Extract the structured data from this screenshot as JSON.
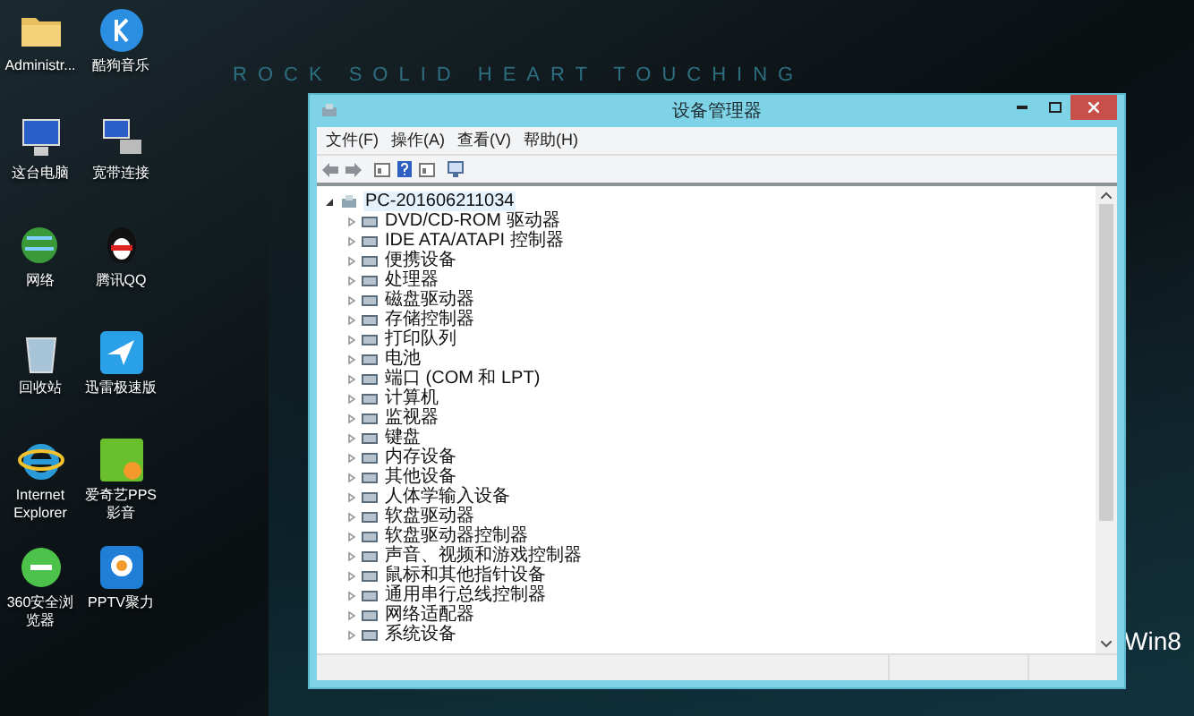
{
  "desktop": {
    "icons": [
      {
        "label": "Administr...",
        "kind": "folder"
      },
      {
        "label": "酷狗音乐",
        "kind": "round-app"
      },
      {
        "label": "这台电脑",
        "kind": "computer"
      },
      {
        "label": "宽带连接",
        "kind": "network"
      },
      {
        "label": "网络",
        "kind": "globe"
      },
      {
        "label": "腾讯QQ",
        "kind": "penguin"
      },
      {
        "label": "回收站",
        "kind": "bin"
      },
      {
        "label": "迅雷极速版",
        "kind": "bird-tile"
      },
      {
        "label": "Internet Explorer",
        "kind": "ie"
      },
      {
        "label": "爱奇艺PPS 影音",
        "kind": "green-tile"
      },
      {
        "label": "360安全浏览器",
        "kind": "green-e"
      },
      {
        "label": "PPTV聚力",
        "kind": "blue-tile"
      }
    ],
    "wallpaper_text": [
      "ROCK SOLID   HEART TOUCHING",
      "Win8"
    ]
  },
  "window": {
    "title": "设备管理器",
    "menu": [
      "文件(F)",
      "操作(A)",
      "查看(V)",
      "帮助(H)"
    ],
    "tree": {
      "label": "PC-201606211034",
      "selected": true,
      "expanded": true,
      "children": [
        {
          "label": "DVD/CD-ROM 驱动器",
          "selected": false
        },
        {
          "label": "IDE ATA/ATAPI 控制器",
          "selected": false
        },
        {
          "label": "便携设备",
          "selected": false
        },
        {
          "label": "处理器",
          "selected": false
        },
        {
          "label": "磁盘驱动器",
          "selected": false
        },
        {
          "label": "存储控制器",
          "selected": false
        },
        {
          "label": "打印队列",
          "selected": false
        },
        {
          "label": "电池",
          "selected": false
        },
        {
          "label": "端口 (COM 和 LPT)",
          "selected": false
        },
        {
          "label": "计算机",
          "selected": false
        },
        {
          "label": "监视器",
          "selected": false
        },
        {
          "label": "键盘",
          "selected": false
        },
        {
          "label": "内存设备",
          "selected": false
        },
        {
          "label": "其他设备",
          "selected": false
        },
        {
          "label": "人体学输入设备",
          "selected": false
        },
        {
          "label": "软盘驱动器",
          "selected": false
        },
        {
          "label": "软盘驱动器控制器",
          "selected": false
        },
        {
          "label": "声音、视频和游戏控制器",
          "selected": false
        },
        {
          "label": "鼠标和其他指针设备",
          "selected": false
        },
        {
          "label": "通用串行总线控制器",
          "selected": false
        },
        {
          "label": "网络适配器",
          "selected": false
        },
        {
          "label": "系统设备",
          "selected": false
        }
      ]
    }
  }
}
